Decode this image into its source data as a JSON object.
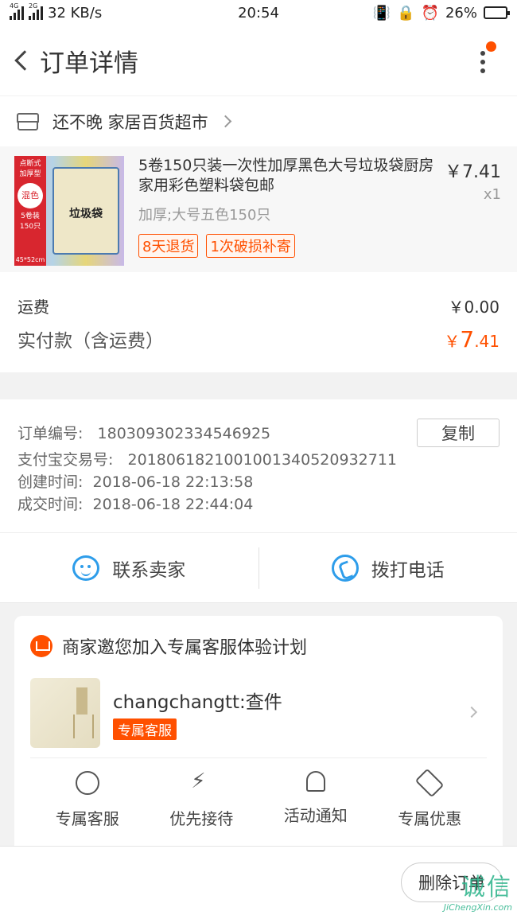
{
  "status": {
    "net_speed": "32 KB/s",
    "time": "20:54",
    "battery": "26%",
    "battery_level": 0.26,
    "sig1": "4G",
    "sig2": "2G"
  },
  "header": {
    "title": "订单详情"
  },
  "store": {
    "name": "还不晚 家居百货超市"
  },
  "product": {
    "title": "5卷150只装一次性加厚黑色大号垃圾袋厨房家用彩色塑料袋包邮",
    "sku": "加厚;大号五色150只",
    "price": "￥7.41",
    "qty": "x1",
    "tags": [
      "8天退货",
      "1次破损补寄"
    ],
    "thumb_texts": [
      "点断式",
      "加厚型",
      "混色",
      "5卷装",
      "150只",
      "45*52cm",
      "垃圾袋"
    ]
  },
  "fees": {
    "shipping_label": "运费",
    "shipping_value": "￥0.00",
    "total_label": "实付款（含运费）",
    "total_currency": "￥",
    "total_int": "7",
    "total_dec": ".41"
  },
  "order": {
    "rows": [
      {
        "key": "订单编号:",
        "value": "180309302334546925"
      },
      {
        "key": "支付宝交易号:",
        "value": "2018061821001001340520932711"
      },
      {
        "key": "创建时间:",
        "value": "2018-06-18 22:13:58"
      },
      {
        "key": "成交时间:",
        "value": "2018-06-18 22:44:04"
      }
    ],
    "copy_label": "复制"
  },
  "contact": {
    "seller": "联系卖家",
    "call": "拨打电话"
  },
  "invite": {
    "title": "商家邀您加入专属客服体验计划",
    "user": "changchangtt:查件",
    "badge": "专属客服",
    "items": [
      "专属客服",
      "优先接待",
      "活动通知",
      "专属优惠"
    ]
  },
  "bottom": {
    "delete_label": "删除订单"
  },
  "watermark": {
    "line1": "诚信",
    "line2": "JiChengXin.com"
  },
  "colors": {
    "accent": "#ff5000",
    "blue": "#2e9dea"
  }
}
